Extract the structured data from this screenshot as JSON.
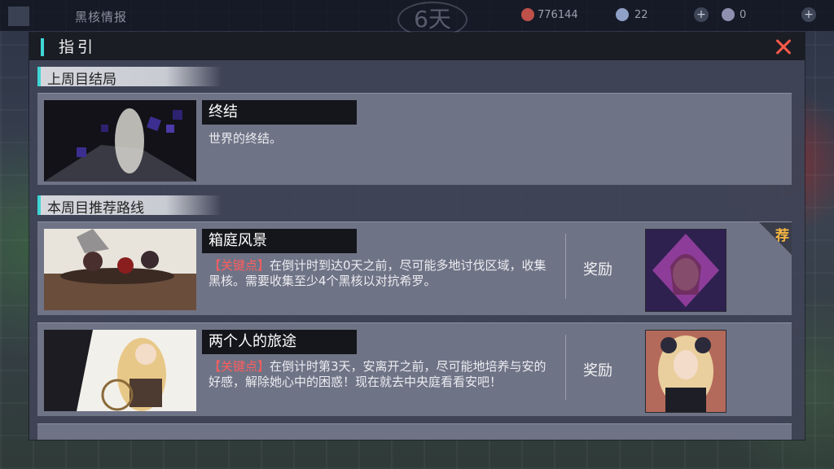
{
  "hud": {
    "title": "黑核情报",
    "day": "6天",
    "currency1": "776144",
    "currency2": "22",
    "currency3": "0",
    "plus": "+"
  },
  "dialog": {
    "title": "指引",
    "sections": {
      "previous": "上周目结局",
      "recommended": "本周目推荐路线"
    },
    "ending": {
      "name": "终结",
      "description": "世界的终结。"
    },
    "routes": [
      {
        "name": "箱庭风景",
        "key_label": "【关键点】",
        "description": "在倒计时到达0天之前，尽可能多地讨伐区域，收集黑核。需要收集至少4个黑核以对抗希罗。",
        "reward_label": "奖励",
        "badge": "荐"
      },
      {
        "name": "两个人的旅途",
        "key_label": "【关键点】",
        "description": "在倒计时第3天，安离开之前，尽可能地培养与安的好感，解除她心中的困惑！现在就去中央庭看看安吧！",
        "reward_label": "奖励"
      }
    ]
  },
  "colors": {
    "accent": "#3fd6d6",
    "close": "#ff5a4a",
    "key": "#ff5e5e",
    "badge": "#f5b640"
  }
}
